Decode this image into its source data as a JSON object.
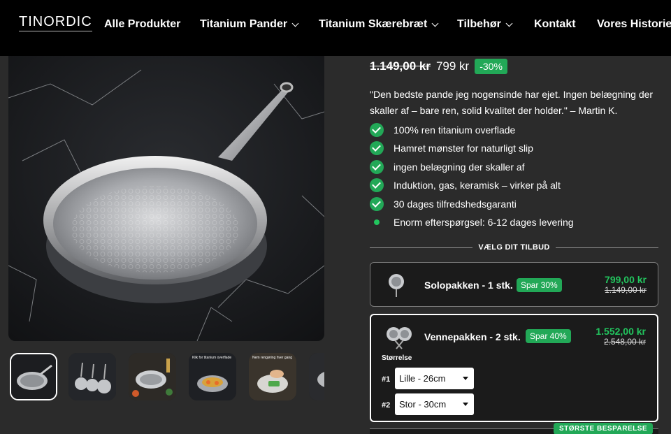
{
  "header": {
    "logo": "TINORDIC",
    "nav": [
      {
        "label": "Alle Produkter"
      },
      {
        "label": "Titanium Pander"
      },
      {
        "label": "Titanium Skærebræt"
      },
      {
        "label": "Tilbehør"
      },
      {
        "label": "Kontakt"
      },
      {
        "label": "Vores Historie"
      }
    ]
  },
  "price": {
    "old": "1.149,00 kr",
    "new": "799 kr",
    "discount": "-30%"
  },
  "quote": "\"Den bedste pande jeg nogensinde har ejet. Ingen belægning der skaller af – bare ren, solid kvalitet der holder.\" – Martin K.",
  "features": [
    "100% ren titanium overflade",
    "Hamret mønster for naturligt slip",
    "ingen belægning der skaller af",
    "Induktion, gas, keramisk – virker på alt",
    "30 dages tilfredshedsgaranti",
    "Enorm efterspørgsel: 6-12 dages levering"
  ],
  "offer_heading": "VÆLG DIT TILBUD",
  "offers": [
    {
      "name": "Solopakken - 1 stk.",
      "badge": "Spar 30%",
      "price": "799,00 kr",
      "old_price": "1.149,00 kr"
    },
    {
      "name": "Vennepakken - 2 stk.",
      "badge": "Spar 40%",
      "price": "1.552,00 kr",
      "old_price": "2.548,00 kr",
      "size_label": "Størrelse",
      "selects": [
        {
          "num": "#1",
          "value": "Lille - 26cm"
        },
        {
          "num": "#2",
          "value": "Stor - 30cm"
        }
      ]
    }
  ],
  "best_badge": "STØRSTE BESPARELSE",
  "thumb_texts": {
    "t4": "Klik for titanium overflade",
    "t5": "Nem rengøring hver gang"
  }
}
